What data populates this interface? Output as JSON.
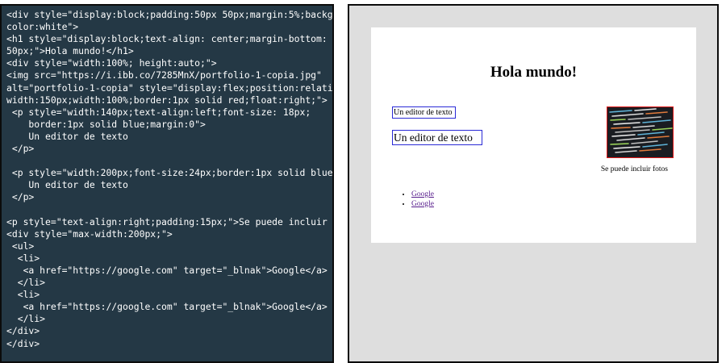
{
  "editor": {
    "code": "<div style=\"display:block;padding:50px 50px;margin:5%;background-\ncolor:white\">\n<h1 style=\"display:block;text-align: center;margin-bottom:\n50px;\">Hola mundo!</h1>\n<div style=\"width:100%; height:auto;\">\n<img src=\"https://i.ibb.co/7285MnX/portfolio-1-copia.jpg\"\nalt=\"portfolio-1-copia\" style=\"display:flex;position:relative;max-\nwidth:150px;width:100%;border:1px solid red;float:right;\">\n <p style=\"width:140px;text-align:left;font-size: 18px;\n    border:1px solid blue;margin:0\">\n    Un editor de texto\n </p>\n\n <p style=\"width:200px;font-size:24px;border:1px solid blue;\">\n    Un editor de texto\n </p>\n\n<p style=\"text-align:right;padding:15px;\">Se puede incluir fotos</p>\n<div style=\"max-width:200px;\">\n <ul>\n  <li>\n   <a href=\"https://google.com\" target=\"_blnak\">Google</a>\n  </li>\n  <li>\n   <a href=\"https://google.com\" target=\"_blnak\">Google</a>\n  </li>\n</div>\n</div>"
  },
  "preview": {
    "heading": "Hola mundo!",
    "paragraph_small": "Un editor de texto",
    "paragraph_large": "Un editor de texto",
    "caption": "Se puede incluir fotos",
    "links": [
      {
        "label": "Google"
      },
      {
        "label": "Google"
      }
    ]
  },
  "colors": {
    "editor_bg": "#243845",
    "preview_bg": "#dedede",
    "image_border": "#e01515",
    "paragraph_border": "#2a2ad6",
    "link": "#551a8b"
  }
}
